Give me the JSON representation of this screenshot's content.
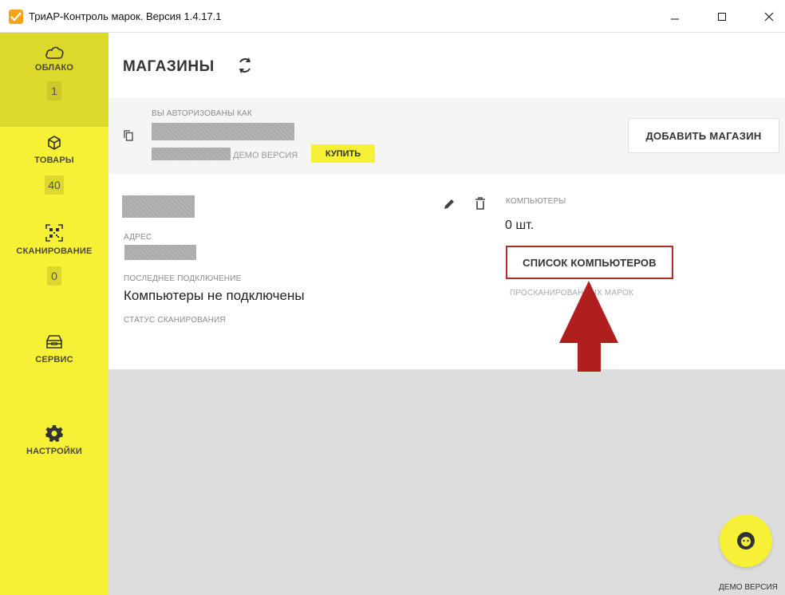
{
  "window": {
    "title": "ТриАР-Контроль марок. Версия 1.4.17.1",
    "min_glyph": "—",
    "max_glyph": "☐",
    "close_glyph": "✕"
  },
  "sidebar": {
    "items": [
      {
        "label": "ОБЛАКО",
        "badge": "1",
        "icon": "cloud-icon"
      },
      {
        "label": "ТОВАРЫ",
        "badge": "40",
        "icon": "box-icon"
      },
      {
        "label": "СКАНИРОВАНИЕ",
        "badge": "0",
        "icon": "qr-scan-icon"
      },
      {
        "label": "СЕРВИС",
        "icon": "service-icon"
      },
      {
        "label": "НАСТРОЙКИ",
        "icon": "gear-icon"
      }
    ]
  },
  "header": {
    "title": "МАГАЗИНЫ",
    "sync_icon": "sync-icon"
  },
  "account": {
    "auth_label": "ВЫ АВТОРИЗОВАНЫ КАК",
    "demo_label": "ДЕМО ВЕРСИЯ",
    "buy_label": "КУПИТЬ",
    "add_store_label": "ДОБАВИТЬ МАГАЗИН"
  },
  "store": {
    "address_label": "АДРЕС",
    "last_connection_label": "ПОСЛЕДНЕЕ ПОДКЛЮЧЕНИЕ",
    "last_connection_value": "Компьютеры не подключены",
    "scan_status_label": "СТАТУС СКАНИРОВАНИЯ",
    "computers_label": "КОМПЬЮТЕРЫ",
    "computers_count": "0 шт.",
    "computers_list_label": "СПИСОК КОМПЬЮТЕРОВ",
    "scanned_marks_label": "ПРОСКАНИРОВАННЫХ МАРОК"
  },
  "fab": {
    "label": "ДЕМО ВЕРСИЯ"
  },
  "colors": {
    "sidebar": "#f6f134",
    "sidebar_active": "#ddd92c",
    "highlight_border": "#b52a2a",
    "arrow": "#b01e1e",
    "app_icon": "#f7a21b"
  }
}
